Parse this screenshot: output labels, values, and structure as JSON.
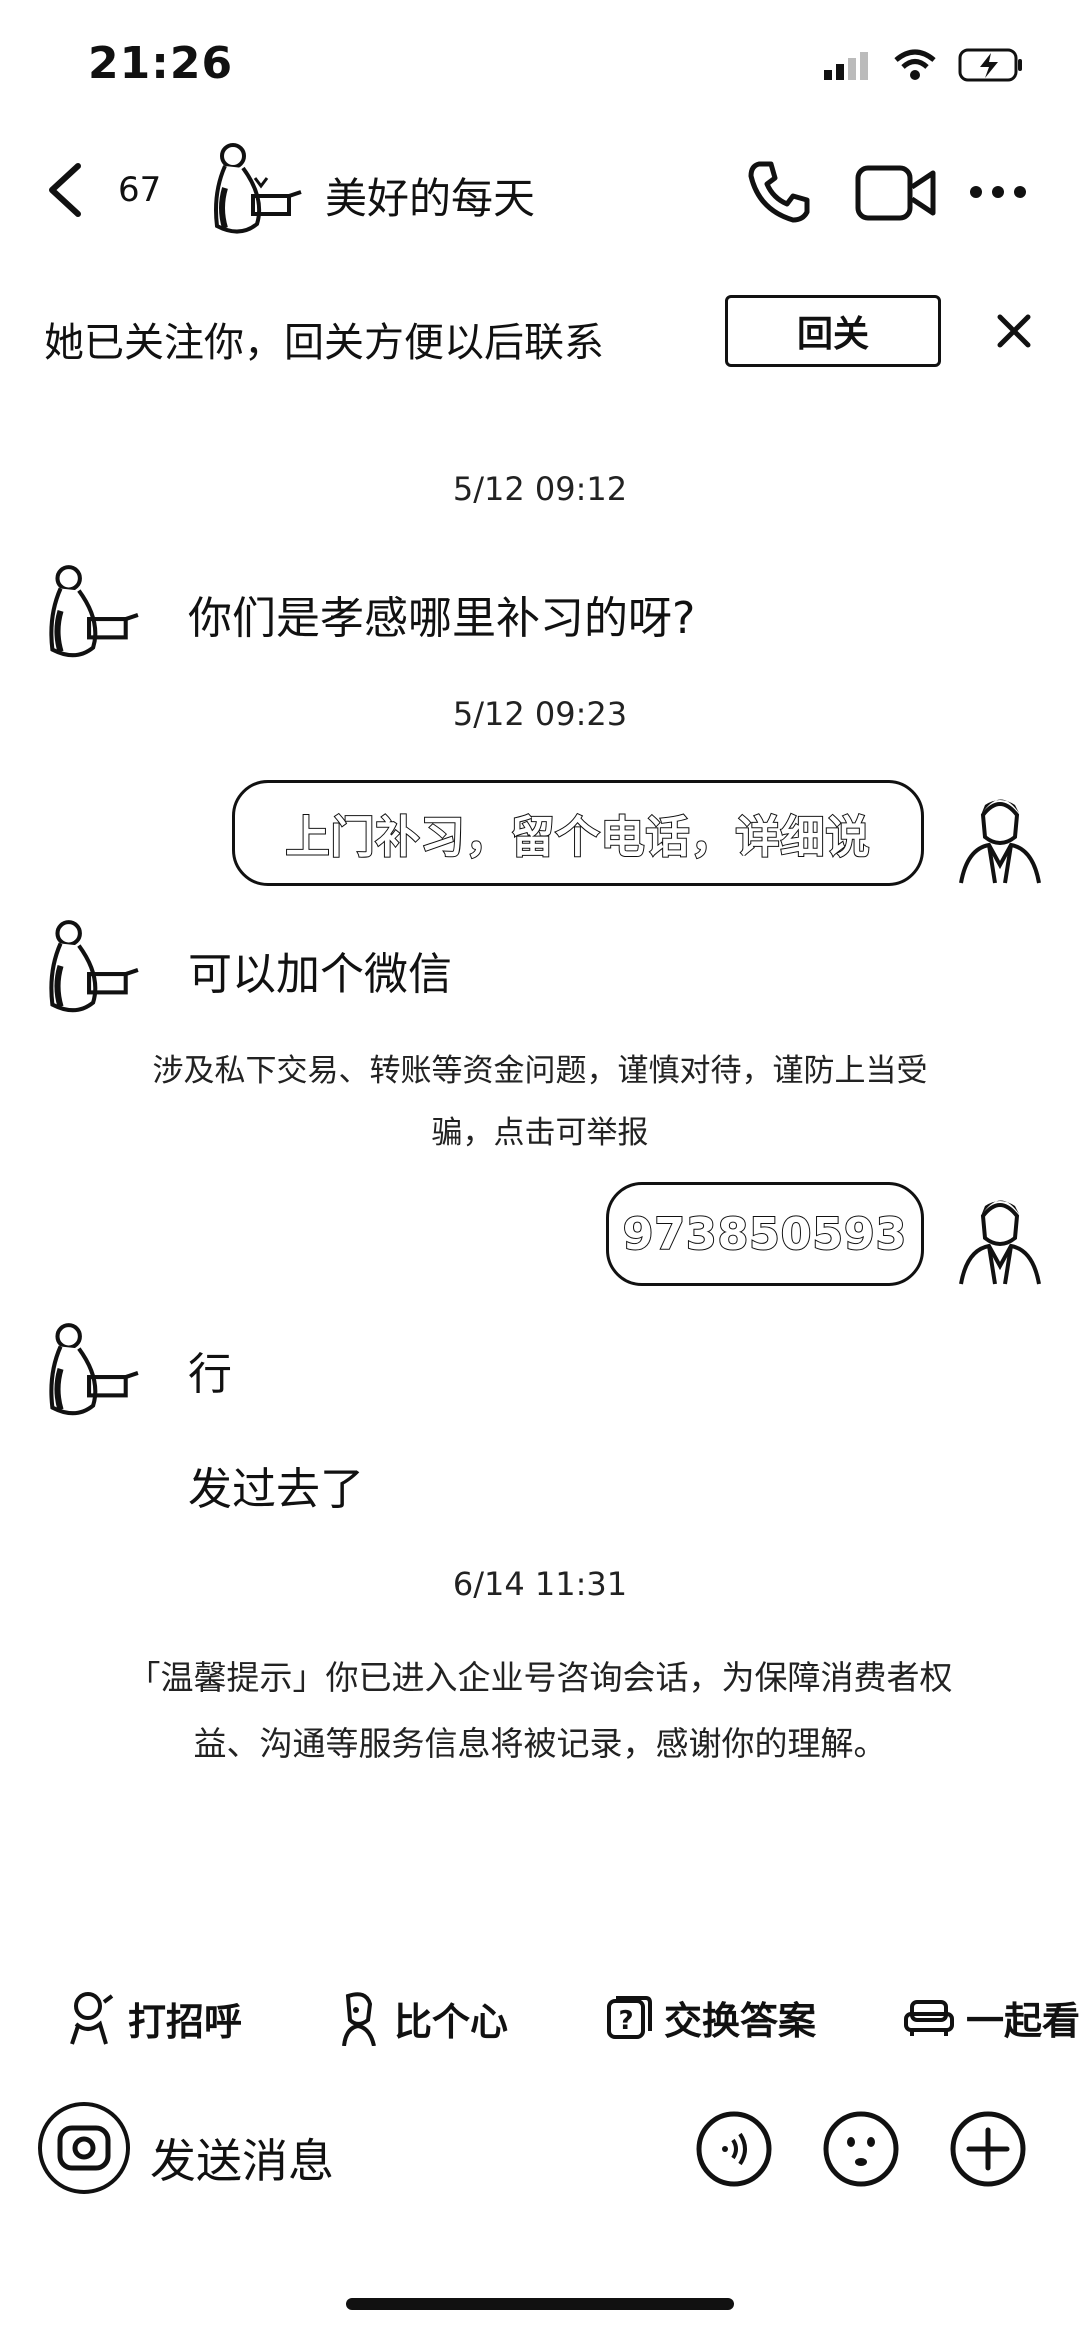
{
  "status_bar": {
    "time": "21:26"
  },
  "header": {
    "unread_count": "67",
    "title": "美好的每天"
  },
  "follow_banner": {
    "text": "她已关注你，回关方便以后联系",
    "button": "回关"
  },
  "messages": {
    "ts1": "5/12 09:12",
    "m1": "你们是孝感哪里补习的呀?",
    "ts2": "5/12 09:23",
    "m2": "上门补习，留个电话，详细说",
    "m3": "可以加个微信",
    "warning_line1": "涉及私下交易、转账等资金问题，谨慎对待，谨防上当受",
    "warning_line2": "骗，点击可举报",
    "m4": "973850593",
    "m5": "行",
    "m6": "发过去了",
    "ts3": "6/14 11:31",
    "tip_line1": "「温馨提示」你已进入企业号咨询会话，为保障消费者权",
    "tip_line2": "益、沟通等服务信息将被记录，感谢你的理解。"
  },
  "quick_actions": [
    {
      "label": "打招呼",
      "icon": "wave-sticker-icon"
    },
    {
      "label": "比个心",
      "icon": "heart-sticker-icon"
    },
    {
      "label": "交换答案",
      "icon": "question-card-icon"
    },
    {
      "label": "一起看",
      "icon": "sofa-icon"
    }
  ],
  "input": {
    "placeholder": "发送消息"
  }
}
